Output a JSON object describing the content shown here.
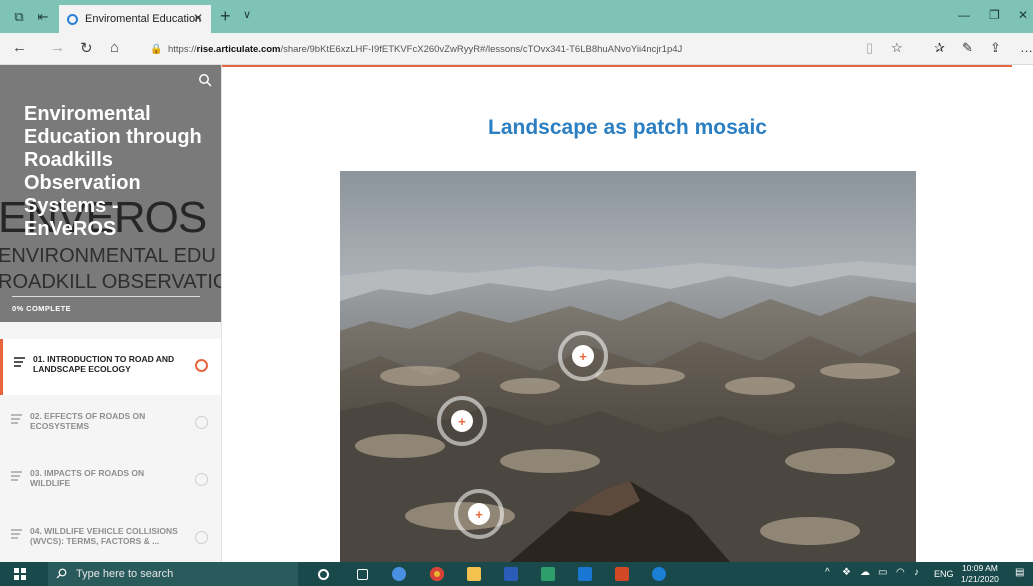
{
  "browser": {
    "tab_title": "Enviromental Education",
    "url_prefix": "https://",
    "url_domain": "rise.articulate.com",
    "url_path": "/share/9bKtE6xzLHF-I9fETKVFcX260vZwRyyR#/lessons/cTOvx341-T6LB8huANvoYii4ncjr1p4J"
  },
  "sidebar": {
    "course_title": "Enviromental Education through Roadkills Observation Systems - EnVeROS",
    "bg_logo_big": "ENVEROS",
    "bg_logo_line1": "ENVIRONMENTAL EDU",
    "bg_logo_line2": "ROADKILL OBSERVATIC",
    "progress_text": "0% COMPLETE",
    "progress_value": 0,
    "lessons": [
      {
        "label": "01. INTRODUCTION TO ROAD AND LANDSCAPE ECOLOGY",
        "active": true
      },
      {
        "label": "02. EFFECTS OF ROADS ON ECOSYSTEMS",
        "active": false
      },
      {
        "label": "03. IMPACTS OF ROADS ON WILDLIFE",
        "active": false
      },
      {
        "label": "04. WILDLIFE VEHICLE COLLISIONS (WVCs): TERMS, FACTORS & ...",
        "active": false
      }
    ]
  },
  "main": {
    "heading": "Landscape as patch mosaic",
    "hotspot_symbol": "+"
  },
  "taskbar": {
    "search_placeholder": "Type here to search",
    "language": "ENG",
    "time": "10:09 AM",
    "date": "1/21/2020"
  },
  "colors": {
    "accent": "#e8663d",
    "heading": "#2b7fc2",
    "tabbar": "#7ec3b5",
    "taskbar": "#19494a"
  }
}
